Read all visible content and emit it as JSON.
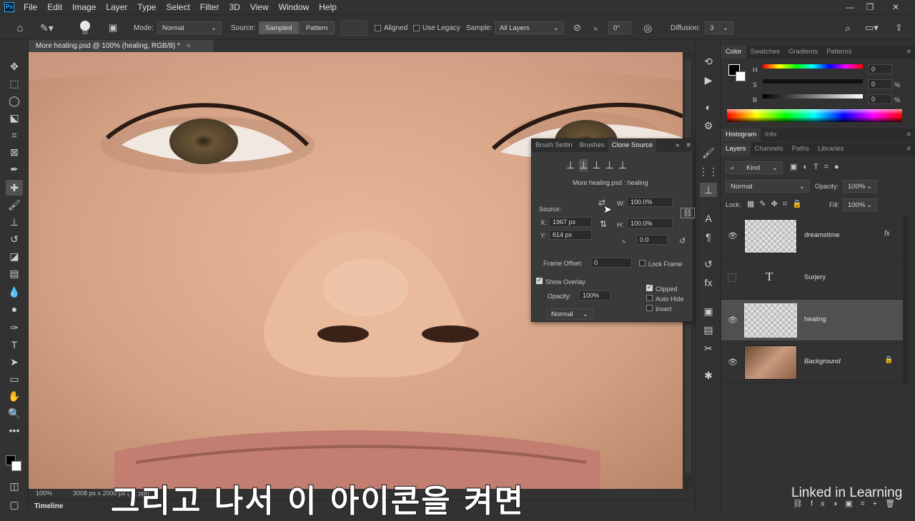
{
  "menubar": {
    "items": [
      "File",
      "Edit",
      "Image",
      "Layer",
      "Type",
      "Select",
      "Filter",
      "3D",
      "View",
      "Window",
      "Help"
    ],
    "logo": "Ps"
  },
  "options": {
    "brush_size": "50",
    "mode_label": "Mode:",
    "mode_value": "Normal",
    "source_label": "Source:",
    "sampled": "Sampled",
    "pattern": "Pattern",
    "aligned": "Aligned",
    "use_legacy": "Use Legacy",
    "sample_label": "Sample:",
    "sample_value": "All Layers",
    "angle": "0°",
    "diffusion_label": "Diffusion:",
    "diffusion_value": "3"
  },
  "doc": {
    "tab": "More healing.psd @ 100% (healing, RGB/8) *"
  },
  "status": {
    "zoom": "100%",
    "dims": "3008 px x 2000 px (72 ppi)"
  },
  "timeline": {
    "label": "Timeline"
  },
  "clone": {
    "tabs": [
      "Brush Settin",
      "Brushes",
      "Clone Source"
    ],
    "doc_name": "More healing.psd : healing",
    "source_label": "Source:",
    "x_label": "X:",
    "x_value": "1967 px",
    "y_label": "Y:",
    "y_value": "614 px",
    "w_label": "W:",
    "w_value": "100.0%",
    "h_label": "H:",
    "h_value": "100.0%",
    "angle_value": "0.0",
    "frame_offset_label": "Frame Offset:",
    "frame_offset_value": "0",
    "lock_frame": "Lock Frame",
    "show_overlay": "Show Overlay",
    "opacity_label": "Opacity:",
    "opacity_value": "100%",
    "clipped": "Clipped",
    "auto_hide": "Auto Hide",
    "invert": "Invert",
    "blend_mode": "Normal"
  },
  "color": {
    "tabs": [
      "Color",
      "Swatches",
      "Gradients",
      "Patterns"
    ],
    "h_label": "H",
    "h_value": "0",
    "s_label": "S",
    "s_value": "0",
    "s_unit": "%",
    "b_label": "B",
    "b_value": "0",
    "b_unit": "%"
  },
  "histo": {
    "tabs": [
      "Histogram",
      "Info"
    ]
  },
  "layers_panel": {
    "tabs": [
      "Layers",
      "Channels",
      "Paths",
      "Libraries"
    ],
    "kind": "Kind",
    "blend": "Normal",
    "opacity_label": "Opacity:",
    "opacity_value": "100%",
    "lock_label": "Lock:",
    "fill_label": "Fill:",
    "fill_value": "100%",
    "layers": [
      {
        "name": "dreamstime"
      },
      {
        "name": "Surjery"
      },
      {
        "name": "healing"
      },
      {
        "name": "Background"
      }
    ]
  },
  "subtitle": "그리고 나서 이 아이콘을 켜면",
  "watermark": "Linked in Learning"
}
